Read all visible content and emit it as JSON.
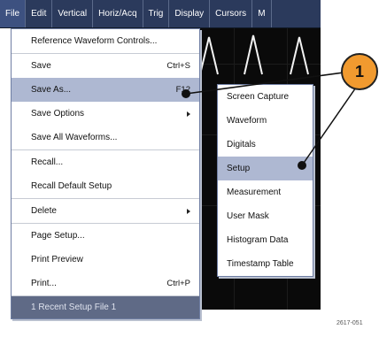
{
  "menubar": {
    "items": [
      "File",
      "Edit",
      "Vertical",
      "Horiz/Acq",
      "Trig",
      "Display",
      "Cursors",
      "M"
    ]
  },
  "file_menu": {
    "items": [
      {
        "label": "Reference Waveform Controls...",
        "shortcut": "",
        "submenu": false
      },
      {
        "label": "Save",
        "shortcut": "Ctrl+S",
        "submenu": false
      },
      {
        "label": "Save As...",
        "shortcut": "F12",
        "submenu": false,
        "highlighted": true
      },
      {
        "label": "Save Options",
        "shortcut": "",
        "submenu": true
      },
      {
        "label": "Save All Waveforms...",
        "shortcut": "",
        "submenu": false
      },
      {
        "label": "Recall...",
        "shortcut": "",
        "submenu": false
      },
      {
        "label": "Recall Default Setup",
        "shortcut": "",
        "submenu": false
      },
      {
        "label": "Delete",
        "shortcut": "",
        "submenu": true
      },
      {
        "label": "Page Setup...",
        "shortcut": "",
        "submenu": false
      },
      {
        "label": "Print Preview",
        "shortcut": "",
        "submenu": false
      },
      {
        "label": "Print...",
        "shortcut": "Ctrl+P",
        "submenu": false
      },
      {
        "label": "1 Recent Setup File 1",
        "shortcut": "",
        "submenu": false
      }
    ]
  },
  "save_as_submenu": {
    "items": [
      "Screen Capture",
      "Waveform",
      "Digitals",
      "Setup",
      "Measurement",
      "User Mask",
      "Histogram Data",
      "Timestamp Table"
    ],
    "highlighted_index": 3
  },
  "callout": {
    "number": "1"
  },
  "figure_id": "2617-051",
  "colors": {
    "menubar": "#2b3a5c",
    "highlight": "#aeb8d2",
    "callout": "#f19a2f"
  }
}
